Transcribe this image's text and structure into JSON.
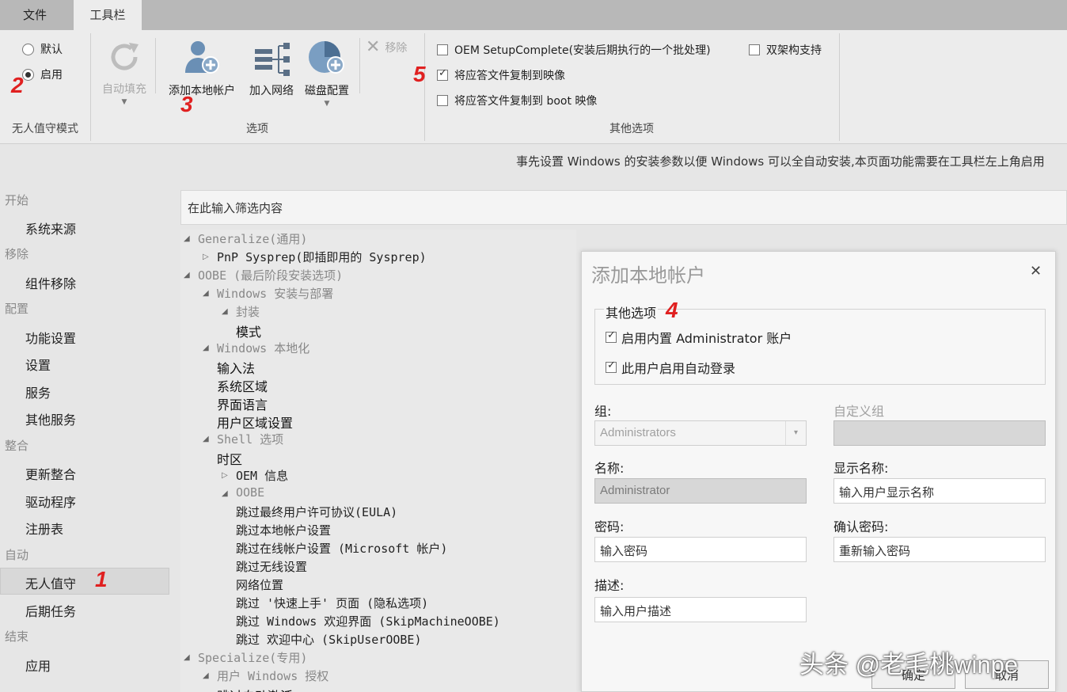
{
  "tabs": {
    "file": "文件",
    "toolbar": "工具栏"
  },
  "ribbon": {
    "mode": {
      "default": "默认",
      "enable": "启用",
      "selected": "启用",
      "label": "无人值守模式"
    },
    "options": {
      "auto_fill": "自动填充",
      "add_local_account": "添加本地帐户",
      "join_network": "加入网络",
      "disk_config": "磁盘配置",
      "remove": "移除",
      "label": "选项"
    },
    "other": {
      "oem_setup": "OEM SetupComplete(安装后期执行的一个批处理)",
      "dual_arch": "双架构支持",
      "copy_to_install": "将应答文件复制到映像",
      "copy_to_boot": "将应答文件复制到 boot 映像",
      "oem_checked": false,
      "dual_checked": false,
      "install_checked": true,
      "boot_checked": false,
      "label": "其他选项"
    }
  },
  "annotations": {
    "n1": "1",
    "n2": "2",
    "n3": "3",
    "n4": "4",
    "n5": "5"
  },
  "description": "事先设置 Windows 的安装参数以便 Windows 可以全自动安装,本页面功能需要在工具栏左上角启用",
  "sidebar": {
    "cat_start": "开始",
    "source": "系统来源",
    "cat_remove": "移除",
    "component_remove": "组件移除",
    "cat_config": "配置",
    "feature_settings": "功能设置",
    "settings": "设置",
    "services": "服务",
    "other_services": "其他服务",
    "cat_integrate": "整合",
    "update_integrate": "更新整合",
    "drivers": "驱动程序",
    "registry": "注册表",
    "cat_auto": "自动",
    "unattended": "无人值守",
    "post_tasks": "后期任务",
    "cat_end": "结束",
    "apply": "应用"
  },
  "filter_placeholder": "在此输入筛选内容",
  "tree": {
    "generalize": "Generalize(通用)",
    "pnp_sysprep": "PnP Sysprep(即插即用的 Sysprep)",
    "oobe": "OOBE (最后阶段安装选项)",
    "windows_install": "Windows 安装与部署",
    "seal": "封装",
    "mode": "模式",
    "windows_local": "Windows 本地化",
    "input_method": "输入法",
    "system_region": "系统区域",
    "ui_language": "界面语言",
    "user_locale": "用户区域设置",
    "shell_options": "Shell 选项",
    "timezone": "时区",
    "oem_info": "OEM 信息",
    "oobe_sub": "OOBE",
    "skip_eula": "跳过最终用户许可协议(EULA)",
    "skip_local_account": "跳过本地帐户设置",
    "skip_online_account": "跳过在线帐户设置 (Microsoft 帐户)",
    "skip_wireless": "跳过无线设置",
    "network_location": "网络位置",
    "skip_quick_start": "跳过 '快速上手' 页面 (隐私选项)",
    "skip_windows_welcome": "跳过 Windows 欢迎界面 (SkipMachineOOBE)",
    "skip_welcome_center": "跳过 欢迎中心 (SkipUserOOBE)",
    "specialize": "Specialize(专用)",
    "user_windows_auth": "用户 Windows 授权",
    "skip_auto_activate": "跳过自动激活"
  },
  "dialog": {
    "title": "添加本地帐户",
    "group_title": "其他选项",
    "enable_admin": "启用内置 Administrator 账户",
    "enable_admin_checked": true,
    "auto_logon": "此用户启用自动登录",
    "auto_logon_checked": true,
    "group_label": "组:",
    "group_value": "Administrators",
    "custom_group_label": "自定义组",
    "name_label": "名称:",
    "name_value": "Administrator",
    "display_name_label": "显示名称:",
    "display_name_placeholder": "输入用户显示名称",
    "password_label": "密码:",
    "password_placeholder": "输入密码",
    "confirm_password_label": "确认密码:",
    "confirm_password_placeholder": "重新输入密码",
    "description_label": "描述:",
    "description_placeholder": "输入用户描述",
    "ok": "确定",
    "cancel": "取消"
  },
  "watermark": "头条 @老毛桃winpe",
  "colors": {
    "annotation": "#e02020",
    "background": "#e6e6e6",
    "tabbar": "#b8b8b8"
  }
}
